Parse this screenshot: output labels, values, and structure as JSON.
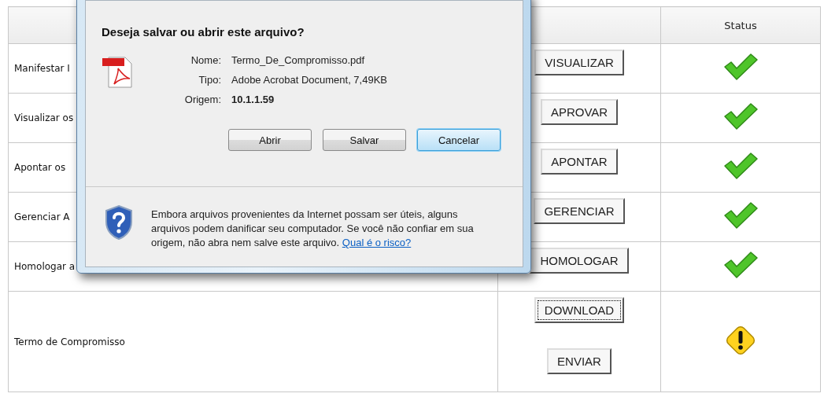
{
  "table": {
    "status_heading": "Status",
    "rows": [
      {
        "kind": "done",
        "label": "Manifestar I",
        "actions": [
          {
            "label": "VISUALIZAR",
            "focused": false
          }
        ]
      },
      {
        "kind": "done",
        "label": "Visualizar os",
        "actions": [
          {
            "label": "APROVAR",
            "focused": false
          }
        ]
      },
      {
        "kind": "done",
        "label": "Apontar os",
        "actions": [
          {
            "label": "APONTAR",
            "focused": false
          }
        ]
      },
      {
        "kind": "done",
        "label": "Gerenciar A",
        "actions": [
          {
            "label": "GERENCIAR",
            "focused": false
          }
        ]
      },
      {
        "kind": "done",
        "label": "Homologar a",
        "actions": [
          {
            "label": "HOMOLOGAR",
            "focused": false
          }
        ]
      },
      {
        "kind": "pending",
        "label": "Termo de Compromisso",
        "actions": [
          {
            "label": "DOWNLOAD",
            "focused": true
          },
          {
            "label": "ENVIAR",
            "focused": false
          }
        ]
      }
    ]
  },
  "dialog": {
    "title": "Deseja salvar ou abrir este arquivo?",
    "file_details": [
      {
        "label": "Nome:",
        "value": "Termo_De_Compromisso.pdf",
        "bold": false
      },
      {
        "label": "Tipo:",
        "value": "Adobe Acrobat Document, 7,49KB",
        "bold": false
      },
      {
        "label": "Origem:",
        "value": "10.1.1.59",
        "bold": true
      }
    ],
    "buttons": [
      {
        "label": "Abrir",
        "default": false
      },
      {
        "label": "Salvar",
        "default": false
      },
      {
        "label": "Cancelar",
        "default": true
      }
    ],
    "warning": {
      "text": "Embora arquivos provenientes da Internet possam ser úteis, alguns arquivos podem danificar seu computador. Se você não confiar em sua origem, não abra nem salve este arquivo.",
      "link": "Qual é o risco?"
    }
  }
}
